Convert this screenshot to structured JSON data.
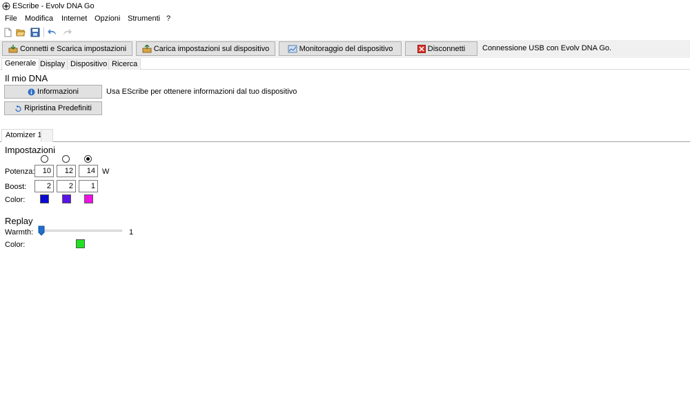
{
  "window": {
    "title": "EScribe - Evolv DNA Go"
  },
  "menu": [
    "File",
    "Modifica",
    "Internet",
    "Opzioni",
    "Strumenti",
    "?"
  ],
  "toolbar_icons": [
    "new-file-icon",
    "open-folder-icon",
    "save-icon",
    "undo-icon",
    "redo-icon"
  ],
  "actions": {
    "connect": "Connetti e Scarica impostazioni",
    "upload": "Carica impostazioni sul dispositivo",
    "monitor": "Monitoraggio del dispositivo",
    "disconnect": "Disconnetti",
    "status": "Connessione USB con Evolv DNA Go."
  },
  "tabs": [
    "Generale",
    "Display",
    "Dispositivo",
    "Ricerca"
  ],
  "general": {
    "heading": "Il mio DNA",
    "info_button": "Informazioni",
    "info_desc": "Usa EScribe per ottenere informazioni dal tuo dispositivo",
    "reset_button": "Ripristina Predefiniti"
  },
  "atomizer_tab": "Atomizer 1",
  "settings": {
    "heading": "Impostazioni",
    "selected_profile_index": 2,
    "power_label": "Potenza:",
    "power_values": [
      "10",
      "12",
      "14"
    ],
    "power_unit": "W",
    "boost_label": "Boost:",
    "boost_values": [
      "2",
      "2",
      "1"
    ],
    "color_label": "Color:",
    "colors": [
      "#0a0ad2",
      "#5a12ea",
      "#f011e4"
    ]
  },
  "replay": {
    "heading": "Replay",
    "warmth_label": "Warmth:",
    "warmth_value": "1",
    "color_label": "Color:",
    "color": "#21e021"
  },
  "colors": {
    "button_face": "#e1e1e1",
    "button_border": "#adadad",
    "tab_border": "#d9d9d9"
  }
}
